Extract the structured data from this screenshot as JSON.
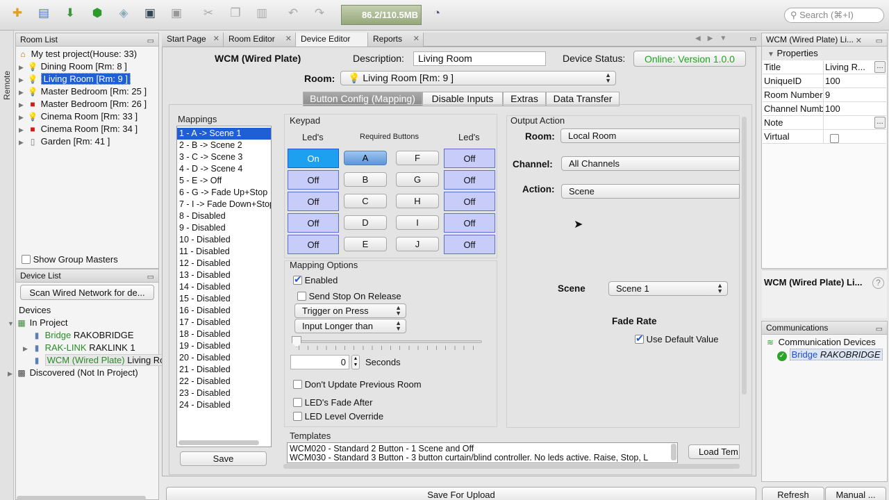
{
  "toolbar": {
    "memory": "86.2/110.5MB",
    "search_placeholder": "Search (⌘+I)"
  },
  "sidebar": {
    "label": "Remote"
  },
  "room_list": {
    "title": "Room List",
    "project": "My test project(House: 33)",
    "rooms": [
      {
        "label": "Dining  Room [Rm: 8 ]",
        "icon": "bulb-icon"
      },
      {
        "label": "Living Room [Rm: 9 ]",
        "icon": "bulb-icon",
        "selected": true
      },
      {
        "label": "Master Bedroom [Rm: 25 ]",
        "icon": "bulb-icon"
      },
      {
        "label": "Master Bedroom [Rm: 26 ]",
        "icon": "red-square-icon"
      },
      {
        "label": "Cinema Room [Rm: 33 ]",
        "icon": "bulb-icon"
      },
      {
        "label": "Cinema Room [Rm: 34 ]",
        "icon": "red-square-icon"
      },
      {
        "label": "Garden [Rm: 41 ]",
        "icon": "switch-icon"
      }
    ],
    "show_group_masters": "Show Group Masters"
  },
  "device_list": {
    "title": "Device List",
    "scan_button": "Scan Wired Network for de...",
    "devices_label": "Devices",
    "in_project": "In Project",
    "items": [
      {
        "type": "Bridge",
        "name": "RAKOBRIDGE"
      },
      {
        "type": "RAK-LINK",
        "name": "RAKLINK 1"
      },
      {
        "type": "WCM (Wired Plate)",
        "name": "Living Room"
      }
    ],
    "discovered": "Discovered (Not In Project)"
  },
  "tabs": {
    "start": "Start Page",
    "room": "Room Editor",
    "device": "Device Editor",
    "reports": "Reports"
  },
  "device_editor": {
    "device_name": "WCM (Wired Plate)",
    "description_label": "Description:",
    "description_value": "Living Room",
    "status_label": "Device Status:",
    "status_value": "Online: Version 1.0.0",
    "room_label": "Room:",
    "room_value": "Living Room [Rm: 9 ]",
    "subtabs": [
      "Button Config (Mapping)",
      "Disable Inputs",
      "Extras",
      "Data Transfer"
    ],
    "mappings_title": "Mappings",
    "mappings": [
      "1 - A -> Scene 1",
      "2 - B -> Scene 2",
      "3 - C -> Scene 3",
      "4 - D -> Scene 4",
      "5 - E -> Off",
      "6 - G -> Fade Up+Stop",
      "7 - I -> Fade Down+Stop",
      "8 - Disabled",
      "9 - Disabled",
      "10 - Disabled",
      "11 - Disabled",
      "12 - Disabled",
      "13 - Disabled",
      "14 - Disabled",
      "15 - Disabled",
      "16 - Disabled",
      "17 - Disabled",
      "18 - Disabled",
      "19 - Disabled",
      "20 - Disabled",
      "21 - Disabled",
      "22 - Disabled",
      "23 - Disabled",
      "24 - Disabled"
    ],
    "save_label": "Save",
    "keypad": {
      "title": "Keypad",
      "leds_left": "Led's",
      "required": "Required Buttons",
      "leds_right": "Led's",
      "left": [
        "On",
        "Off",
        "Off",
        "Off",
        "Off"
      ],
      "col1": [
        "A",
        "B",
        "C",
        "D",
        "E"
      ],
      "col2": [
        "F",
        "G",
        "H",
        "I",
        "J"
      ],
      "right": [
        "Off",
        "Off",
        "Off",
        "Off",
        "Off"
      ]
    },
    "mapping_options": {
      "title": "Mapping Options",
      "enabled": "Enabled",
      "send_stop": "Send Stop On Release",
      "trigger": "Trigger on Press",
      "input_longer": "Input Longer than",
      "seconds_value": "0",
      "seconds_label": "Seconds",
      "dont_update": "Don't Update Previous Room",
      "leds_fade": "LED's Fade After",
      "led_override": "LED Level Override"
    },
    "output": {
      "title": "Output Action",
      "room_label": "Room:",
      "room_value": "Local Room",
      "channel_label": "Channel:",
      "channel_value": "All Channels",
      "action_label": "Action:",
      "action_value": "Scene",
      "scene_label": "Scene",
      "scene_value": "Scene 1",
      "fade_label": "Fade Rate",
      "default_label": "Use Default Value"
    },
    "templates": {
      "title": "Templates",
      "items": [
        "WCM020 - Standard 2 Button - 1 Scene and Off",
        "WCM030 - Standard 3 Button - 3 button curtain/blind controller. No leds active. Raise, Stop, L"
      ],
      "load": "Load Tem"
    },
    "save_upload": "Save For Upload"
  },
  "properties": {
    "tab": "WCM (Wired Plate) Li...",
    "header": "Properties",
    "rows": [
      {
        "k": "Title",
        "v": "Living R..."
      },
      {
        "k": "UniqueID",
        "v": "100"
      },
      {
        "k": "Room Number",
        "v": "9"
      },
      {
        "k": "Channel Numb",
        "v": "100"
      },
      {
        "k": "Note",
        "v": ""
      },
      {
        "k": "Virtual",
        "v": ""
      }
    ],
    "footer": "WCM (Wired Plate) Li..."
  },
  "communications": {
    "title": "Communications",
    "devices": "Communication Devices",
    "bridge_type": "Bridge",
    "bridge_name": "RAKOBRIDGE"
  },
  "bottom": {
    "refresh": "Refresh",
    "manual": "Manual ..."
  }
}
